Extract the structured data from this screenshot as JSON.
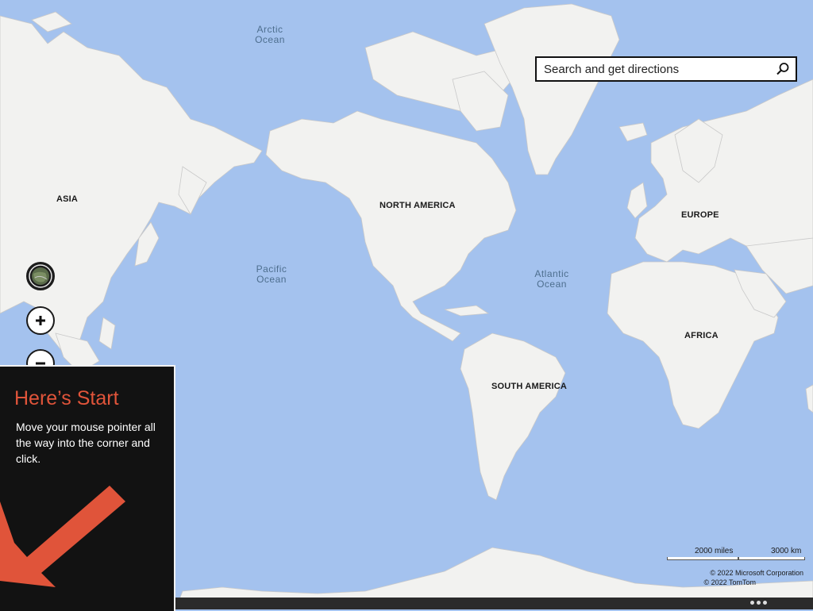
{
  "map": {
    "oceans": [
      {
        "id": "arctic",
        "line1": "Arctic",
        "line2": "Ocean"
      },
      {
        "id": "pacific",
        "line1": "Pacific",
        "line2": "Ocean"
      },
      {
        "id": "atlantic",
        "line1": "Atlantic",
        "line2": "Ocean"
      }
    ],
    "continents": {
      "asia": "ASIA",
      "north_america": "NORTH AMERICA",
      "europe": "EUROPE",
      "africa": "AFRICA",
      "south_america": "SOUTH AMERICA"
    },
    "colors": {
      "water": "#a4c2ee",
      "land": "#f2f2f0",
      "border": "#c8c8c8"
    }
  },
  "search": {
    "placeholder": "Search and get directions",
    "icon": "search-icon"
  },
  "controls": {
    "location_icon": "globe-icon",
    "zoom_in_icon": "plus-icon",
    "zoom_out_icon": "minus-icon"
  },
  "start_tip": {
    "title": "Here’s Start",
    "body": "Move your mouse pointer all the way into the corner and click.",
    "accent_color": "#e0543a"
  },
  "scale": {
    "miles": "2000 miles",
    "km": "3000 km"
  },
  "copyright": {
    "line1": "© 2022 Microsoft Corporation",
    "line2": "© 2022 TomTom"
  },
  "app_bar": {
    "more_icon": "ellipsis-icon"
  }
}
